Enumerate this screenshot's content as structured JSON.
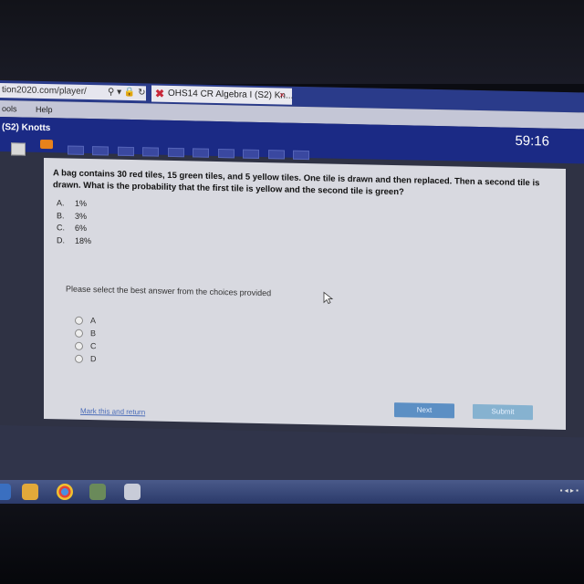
{
  "browser": {
    "url": "tion2020.com/player/",
    "url_icons": "⚲ ▾ 🔒 ↻",
    "tab_title": "OHS14 CR Algebra I (S2) Kn...",
    "tab_close": "×"
  },
  "menu": [
    "ools",
    "Help"
  ],
  "app": {
    "course_title": "(S2) Knotts",
    "timer": "59:16"
  },
  "question": {
    "text": "A bag contains 30 red tiles, 15 green tiles, and 5 yellow tiles. One tile is drawn and then replaced. Then a second tile is drawn. What is the probability that the first tile is yellow and the second tile is green?",
    "options": [
      {
        "letter": "A.",
        "value": "1%"
      },
      {
        "letter": "B.",
        "value": "3%"
      },
      {
        "letter": "C.",
        "value": "6%"
      },
      {
        "letter": "D.",
        "value": "18%"
      }
    ],
    "instruction": "Please select the best answer from the choices provided",
    "radio_labels": [
      "A",
      "B",
      "C",
      "D"
    ]
  },
  "actions": {
    "mark_link": "Mark this and return",
    "next": "Next",
    "submit": "Submit"
  },
  "colors": {
    "header": "#1b2a85",
    "browser_bar": "#2a3b8a",
    "content_bg": "#d8d9e0"
  }
}
